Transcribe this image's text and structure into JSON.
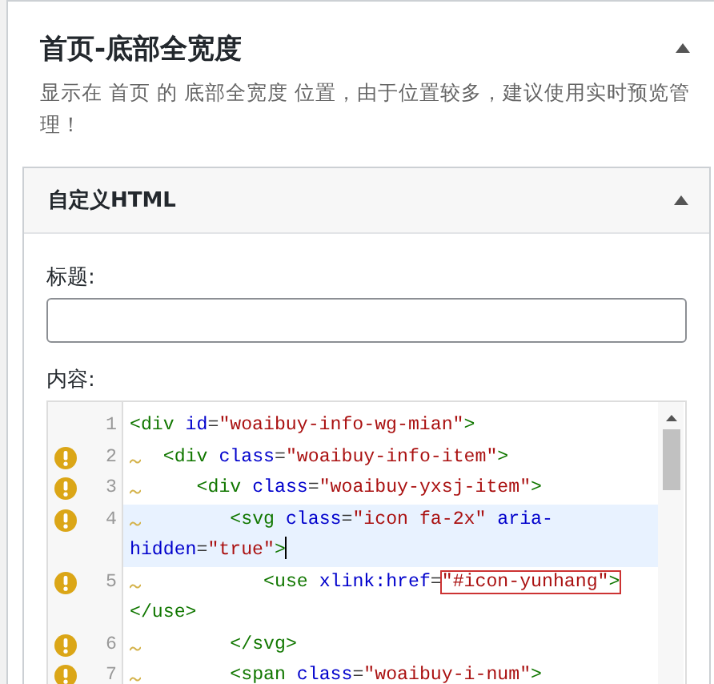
{
  "panel": {
    "title": "首页-底部全宽度",
    "expanded": true,
    "description": "显示在 首页 的 底部全宽度 位置，由于位置较多，建议使用实时预览管理！"
  },
  "widget": {
    "title": "自定义HTML",
    "expanded": true,
    "fields": [
      {
        "label": "标题:"
      }
    ],
    "editor": {
      "label": "内容:",
      "lines": [
        {
          "number": "1",
          "warning": false,
          "active": false,
          "tokens": [
            {
              "kind": "tag",
              "text": "<div"
            },
            {
              "kind": "attr",
              "text": " id"
            },
            {
              "kind": "plain",
              "text": "="
            },
            {
              "kind": "string",
              "text": "\"woaibuy-info-wg-mian\""
            },
            {
              "kind": "tag",
              "text": ">"
            }
          ]
        },
        {
          "number": "2",
          "warning": true,
          "active": false,
          "tokens": [
            {
              "kind": "tag",
              "text": "  <div"
            },
            {
              "kind": "attr",
              "text": " class"
            },
            {
              "kind": "plain",
              "text": "="
            },
            {
              "kind": "string",
              "text": "\"woaibuy-info-item\""
            },
            {
              "kind": "tag",
              "text": ">"
            }
          ]
        },
        {
          "number": "3",
          "warning": true,
          "active": false,
          "tokens": [
            {
              "kind": "tag",
              "text": "     <div"
            },
            {
              "kind": "attr",
              "text": " class"
            },
            {
              "kind": "plain",
              "text": "="
            },
            {
              "kind": "string",
              "text": "\"woaibuy-yxsj-item\""
            },
            {
              "kind": "tag",
              "text": ">"
            }
          ]
        },
        {
          "number": "4",
          "warning": true,
          "active": true,
          "tokens": [
            {
              "kind": "tag",
              "text": "        <svg"
            },
            {
              "kind": "attr",
              "text": " class"
            },
            {
              "kind": "plain",
              "text": "="
            },
            {
              "kind": "string",
              "text": "\"icon fa-2x\""
            },
            {
              "kind": "attr",
              "text": " aria-hidden"
            },
            {
              "kind": "plain",
              "text": "="
            },
            {
              "kind": "string",
              "text": "\"true\""
            },
            {
              "kind": "tag",
              "text": ">"
            }
          ]
        },
        {
          "number": "5",
          "warning": true,
          "active": false,
          "tokens": [
            {
              "kind": "tag",
              "text": "           <use"
            },
            {
              "kind": "attr",
              "text": " xlink:href"
            },
            {
              "kind": "plain",
              "text": "="
            },
            {
              "kind": "match",
              "tokens": [
                {
                  "kind": "string",
                  "text": "\"#icon-yunhang\""
                },
                {
                  "kind": "tag",
                  "text": ">"
                }
              ]
            },
            {
              "kind": "tag",
              "text": "</use>"
            }
          ]
        },
        {
          "number": "6",
          "warning": true,
          "active": false,
          "tokens": [
            {
              "kind": "tag",
              "text": "        </svg>"
            }
          ]
        },
        {
          "number": "7",
          "warning": true,
          "active": false,
          "tokens": [
            {
              "kind": "tag",
              "text": "        <span"
            },
            {
              "kind": "attr",
              "text": " class"
            },
            {
              "kind": "plain",
              "text": "="
            },
            {
              "kind": "string",
              "text": "\"woaibuy-i-num\""
            },
            {
              "kind": "tag",
              "text": ">"
            }
          ]
        }
      ]
    }
  }
}
